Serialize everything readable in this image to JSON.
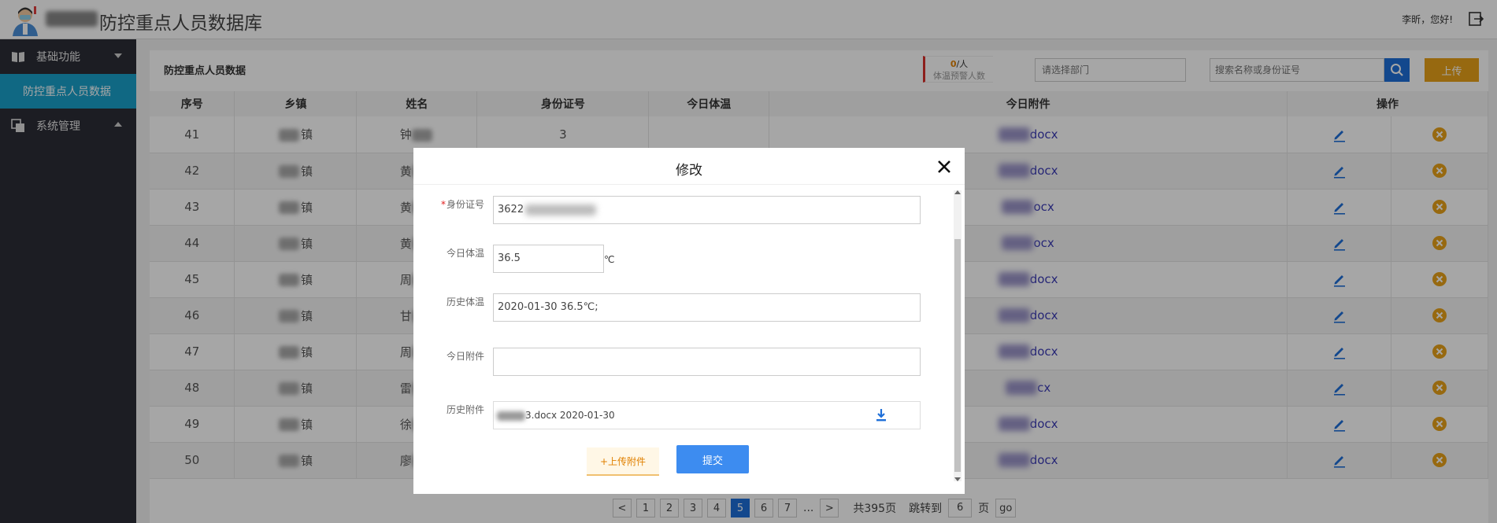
{
  "header": {
    "app_title": "防控重点人员数据库",
    "greeting": "李昕，您好!"
  },
  "sidebar": {
    "groups": [
      {
        "label": "基础功能",
        "expanded": true,
        "items": [
          {
            "label": "防控重点人员数据",
            "active": true
          }
        ]
      },
      {
        "label": "系统管理",
        "expanded": false,
        "items": []
      }
    ]
  },
  "main": {
    "title": "防控重点人员数据",
    "warning": {
      "count": "0",
      "unit": "/人",
      "label": "体温预警人数"
    },
    "dept_placeholder": "请选择部门",
    "search_placeholder": "搜索名称或身份证号",
    "upload_label": "上传",
    "columns": [
      "序号",
      "乡镇",
      "姓名",
      "身份证号",
      "今日体温",
      "今日附件",
      "操作"
    ],
    "rows": [
      {
        "no": "41",
        "town": "镇",
        "name": "钟",
        "id": "3",
        "attachment": "docx"
      },
      {
        "no": "42",
        "town": "镇",
        "name": "黄",
        "id": "",
        "attachment": "docx"
      },
      {
        "no": "43",
        "town": "镇",
        "name": "黄",
        "id": "",
        "attachment": "ocx"
      },
      {
        "no": "44",
        "town": "镇",
        "name": "黄",
        "id": "",
        "attachment": "ocx"
      },
      {
        "no": "45",
        "town": "镇",
        "name": "周",
        "id": "",
        "attachment": "docx"
      },
      {
        "no": "46",
        "town": "镇",
        "name": "甘",
        "id": "",
        "attachment": "docx"
      },
      {
        "no": "47",
        "town": "镇",
        "name": "周",
        "id": "",
        "attachment": "docx"
      },
      {
        "no": "48",
        "town": "镇",
        "name": "雷",
        "id": "",
        "attachment": "cx"
      },
      {
        "no": "49",
        "town": "镇",
        "name": "徐",
        "id": "",
        "attachment": "docx"
      },
      {
        "no": "50",
        "town": "镇",
        "name": "廖",
        "id": "",
        "attachment": "docx"
      }
    ]
  },
  "pagination": {
    "prev": "<",
    "pages": [
      "1",
      "2",
      "3",
      "4",
      "5",
      "6",
      "7"
    ],
    "current": "5",
    "ellipsis": "...",
    "next": ">",
    "total_text": "共395页",
    "jump_label": "跳转到",
    "jump_value": "6",
    "page_unit": "页",
    "go_label": "go"
  },
  "modal": {
    "title": "修改",
    "fields": {
      "id_label": "身份证号",
      "id_value": "3622",
      "temp_label": "今日体温",
      "temp_value": "36.5",
      "temp_unit": "℃",
      "history_temp_label": "历史体温",
      "history_temp_value": "2020-01-30 36.5℃;",
      "today_attach_label": "今日附件",
      "today_attach_value": "",
      "history_attach_label": "历史附件",
      "history_attach_value": "3.docx 2020-01-30"
    },
    "upload_attach_label": "+上传附件",
    "submit_label": "提交"
  },
  "colors": {
    "sidebar_bg": "#2b2d36",
    "sidebar_active": "#1aa0c9",
    "primary": "#1e6fd9",
    "upload_orange": "#e8a11a",
    "delete_orange": "#e8a11a",
    "link_purple": "#3b3bb5"
  },
  "icons": {
    "logo": "doctor-avatar-icon",
    "logout": "logout-icon",
    "group1": "book-icon",
    "group2": "copy-icon",
    "search": "search-icon",
    "edit": "pencil-icon",
    "delete": "close-circle-icon",
    "close": "close-icon",
    "download": "download-icon"
  }
}
